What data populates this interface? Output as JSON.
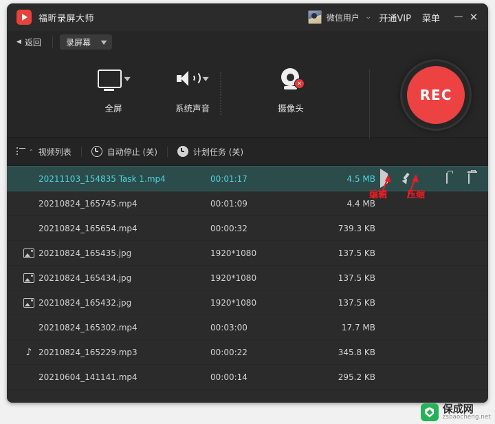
{
  "window": {
    "title": "福昕录屏大师",
    "logo_icon": "play-logo-icon",
    "user_name": "微信用户",
    "user_caret": "⌄",
    "vip_label": "开通VIP",
    "menu_label": "菜单",
    "minimize_label": "—",
    "close_label": "✕"
  },
  "subbar": {
    "back_arrow": "◀",
    "back_label": "返回",
    "mode_label": "录屏幕",
    "mode_caret": "▼"
  },
  "toolbar": {
    "tools": [
      {
        "label": "全屏",
        "icon": "monitor-icon",
        "caret": "▼"
      },
      {
        "label": "系统声音",
        "icon": "speaker-icon",
        "caret": "▼"
      },
      {
        "label": "摄像头",
        "icon": "webcam-icon",
        "badge": "✕"
      }
    ],
    "record_label": "REC"
  },
  "tabs": [
    {
      "label": "视频列表",
      "icon": "list-icon",
      "caret": "⌃"
    },
    {
      "label": "自动停止 (关)",
      "icon": "clock-icon"
    },
    {
      "label": "计划任务 (关)",
      "icon": "clock-filled-icon"
    }
  ],
  "file_list": {
    "rows": [
      {
        "icon": "",
        "name": "20211103_154835 Task 1.mp4",
        "duration": "00:01:17",
        "size": "4.5 MB",
        "selected": true
      },
      {
        "icon": "",
        "name": "20210824_165745.mp4",
        "duration": "00:01:09",
        "size": "4.4 MB",
        "selected": false
      },
      {
        "icon": "",
        "name": "20210824_165654.mp4",
        "duration": "00:00:32",
        "size": "739.3 KB",
        "selected": false
      },
      {
        "icon": "image-icon",
        "name": "20210824_165435.jpg",
        "duration": "1920*1080",
        "size": "137.5 KB",
        "selected": false
      },
      {
        "icon": "image-icon",
        "name": "20210824_165434.jpg",
        "duration": "1920*1080",
        "size": "137.5 KB",
        "selected": false
      },
      {
        "icon": "image-icon",
        "name": "20210824_165432.jpg",
        "duration": "1920*1080",
        "size": "137.5 KB",
        "selected": false
      },
      {
        "icon": "",
        "name": "20210824_165302.mp4",
        "duration": "00:03:00",
        "size": "17.7 MB",
        "selected": false
      },
      {
        "icon": "music-note-icon",
        "name": "20210824_165229.mp3",
        "duration": "00:00:22",
        "size": "345.8 KB",
        "selected": false
      },
      {
        "icon": "",
        "name": "20210604_141141.mp4",
        "duration": "00:00:14",
        "size": "295.2 KB",
        "selected": false
      }
    ],
    "row_actions": [
      {
        "icon": "play-icon"
      },
      {
        "icon": "edit-brush-icon"
      },
      {
        "icon": "compress-save-icon"
      },
      {
        "icon": "folder-icon"
      },
      {
        "icon": "trash-icon"
      }
    ]
  },
  "annotations": [
    {
      "text": "编辑",
      "color": "#ec1c24"
    },
    {
      "text": "压缩",
      "color": "#ec1c24"
    }
  ],
  "watermark": {
    "name_cn": "保成网",
    "name_en": "zsbaocheng.net",
    "logo_icon": "shield-icon"
  },
  "colors": {
    "accent_red": "#ec4242",
    "selected_row_bg": "#2c4b4b",
    "selected_row_text": "#4fd5e0",
    "annotation_red": "#ec1c24",
    "watermark_green": "#27b158"
  }
}
